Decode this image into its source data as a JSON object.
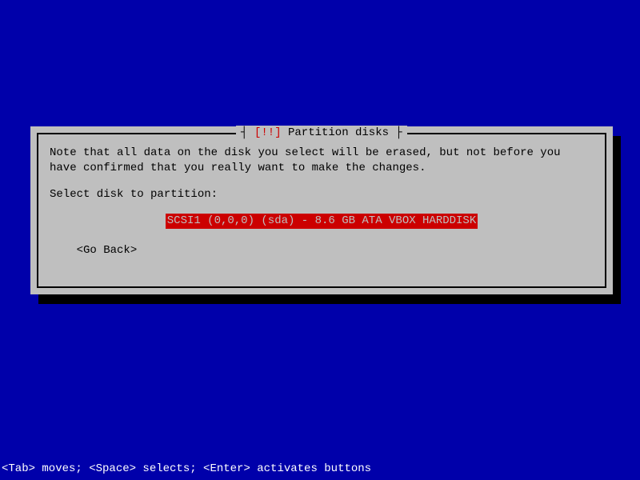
{
  "dialog": {
    "title_prefix": "[!!]",
    "title_text": " Partition disks ",
    "note": "Note that all data on the disk you select will be erased, but not before you have confirmed that you really want to make the changes.",
    "prompt": "Select disk to partition:",
    "disk_options": [
      "SCSI1 (0,0,0) (sda) - 8.6 GB ATA VBOX HARDDISK"
    ],
    "go_back": "<Go Back>"
  },
  "footer": "<Tab> moves; <Space> selects; <Enter> activates buttons"
}
